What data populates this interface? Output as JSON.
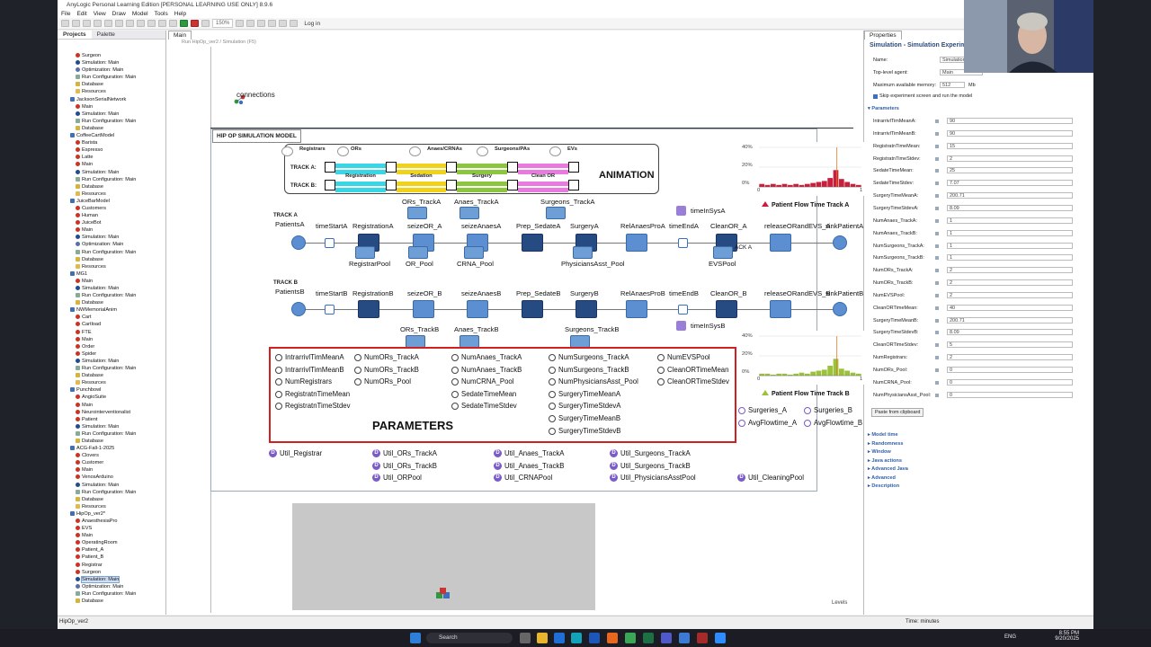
{
  "window": {
    "title": "AnyLogic Personal Learning Edition [PERSONAL LEARNING USE ONLY] 8.9.6",
    "menu": [
      "File",
      "Edit",
      "View",
      "Draw",
      "Model",
      "Tools",
      "Help"
    ],
    "zoom": "150%",
    "login": "Log in"
  },
  "left_panel": {
    "tabs": [
      "Projects",
      "Palette"
    ],
    "tree": [
      {
        "label": "Surgeon",
        "icon": "agent"
      },
      {
        "label": "Simulation: Main",
        "icon": "sim"
      },
      {
        "label": "Optimization: Main",
        "icon": "opt"
      },
      {
        "label": "Run Configuration: Main",
        "icon": "run"
      },
      {
        "label": "Database",
        "icon": "db"
      },
      {
        "label": "Resources",
        "icon": "folder"
      },
      {
        "label": "JacksonSerialNetwork",
        "icon": "model"
      },
      {
        "label": "Main",
        "icon": "agent"
      },
      {
        "label": "Simulation: Main",
        "icon": "sim"
      },
      {
        "label": "Run Configuration: Main",
        "icon": "run"
      },
      {
        "label": "Database",
        "icon": "db"
      },
      {
        "label": "CoffeeCartModel",
        "icon": "model"
      },
      {
        "label": "Barista",
        "icon": "agent"
      },
      {
        "label": "Espresso",
        "icon": "agent"
      },
      {
        "label": "Latte",
        "icon": "agent"
      },
      {
        "label": "Main",
        "icon": "agent"
      },
      {
        "label": "Simulation: Main",
        "icon": "sim"
      },
      {
        "label": "Run Configuration: Main",
        "icon": "run"
      },
      {
        "label": "Database",
        "icon": "db"
      },
      {
        "label": "Resources",
        "icon": "folder"
      },
      {
        "label": "JuiceBarModel",
        "icon": "model"
      },
      {
        "label": "Customers",
        "icon": "agent"
      },
      {
        "label": "Human",
        "icon": "agent"
      },
      {
        "label": "JuiceBot",
        "icon": "agent"
      },
      {
        "label": "Main",
        "icon": "agent"
      },
      {
        "label": "Simulation: Main",
        "icon": "sim"
      },
      {
        "label": "Optimization: Main",
        "icon": "opt"
      },
      {
        "label": "Run Configuration: Main",
        "icon": "run"
      },
      {
        "label": "Database",
        "icon": "db"
      },
      {
        "label": "Resources",
        "icon": "folder"
      },
      {
        "label": "MG1",
        "icon": "model"
      },
      {
        "label": "Main",
        "icon": "agent"
      },
      {
        "label": "Simulation: Main",
        "icon": "sim"
      },
      {
        "label": "Run Configuration: Main",
        "icon": "run"
      },
      {
        "label": "Database",
        "icon": "db"
      },
      {
        "label": "NWMemorialAnim",
        "icon": "model"
      },
      {
        "label": "Cart",
        "icon": "agent"
      },
      {
        "label": "Cartload",
        "icon": "agent"
      },
      {
        "label": "FTE",
        "icon": "agent"
      },
      {
        "label": "Main",
        "icon": "agent"
      },
      {
        "label": "Order",
        "icon": "agent"
      },
      {
        "label": "Spider",
        "icon": "agent"
      },
      {
        "label": "Simulation: Main",
        "icon": "sim"
      },
      {
        "label": "Run Configuration: Main",
        "icon": "run"
      },
      {
        "label": "Database",
        "icon": "db"
      },
      {
        "label": "Resources",
        "icon": "folder"
      },
      {
        "label": "Punchbowl",
        "icon": "model"
      },
      {
        "label": "AngioSuite",
        "icon": "agent"
      },
      {
        "label": "Main",
        "icon": "agent"
      },
      {
        "label": "Neurointerventionalist",
        "icon": "agent"
      },
      {
        "label": "Patient",
        "icon": "agent"
      },
      {
        "label": "Simulation: Main",
        "icon": "sim"
      },
      {
        "label": "Run Configuration: Main",
        "icon": "run"
      },
      {
        "label": "Database",
        "icon": "db"
      },
      {
        "label": "ACG-Fall-1-2025",
        "icon": "model"
      },
      {
        "label": "Clovers",
        "icon": "agent"
      },
      {
        "label": "Customer",
        "icon": "agent"
      },
      {
        "label": "Main",
        "icon": "agent"
      },
      {
        "label": "VenosArduino",
        "icon": "agent"
      },
      {
        "label": "Simulation: Main",
        "icon": "sim"
      },
      {
        "label": "Run Configuration: Main",
        "icon": "run"
      },
      {
        "label": "Database",
        "icon": "db"
      },
      {
        "label": "Resources",
        "icon": "folder"
      },
      {
        "label": "HipOp_ver2*",
        "icon": "model"
      },
      {
        "label": "AnaesthesiaPro",
        "icon": "agent"
      },
      {
        "label": "EVS",
        "icon": "agent"
      },
      {
        "label": "Main",
        "icon": "agent"
      },
      {
        "label": "OperatingRoom",
        "icon": "agent"
      },
      {
        "label": "Patient_A",
        "icon": "agent"
      },
      {
        "label": "Patient_B",
        "icon": "agent"
      },
      {
        "label": "Registrar",
        "icon": "agent"
      },
      {
        "label": "Surgeon",
        "icon": "agent"
      },
      {
        "label": "Simulation: Main",
        "icon": "sim",
        "selected": true
      },
      {
        "label": "Optimization: Main",
        "icon": "opt"
      },
      {
        "label": "Run Configuration: Main",
        "icon": "run"
      },
      {
        "label": "Database",
        "icon": "db"
      }
    ]
  },
  "editor": {
    "tab": "Main",
    "run_hint": "Run HipOp_ver2 / Simulation (F5)",
    "connections_label": "connections",
    "frame_title": "HIP OP SIMULATION MODEL",
    "animation": {
      "title": "ANIMATION",
      "resources": [
        "Registrars",
        "ORs",
        "Anaes/CRNAs",
        "Surgeons/PAs",
        "EVs"
      ],
      "track_a": "TRACK A:",
      "track_b": "TRACK B:",
      "stages": [
        "Registration",
        "Sedation",
        "Surgery",
        "Clean OR"
      ],
      "stage_colors": [
        "#39d6e6",
        "#f0d21a",
        "#8cc63f",
        "#e87ae0"
      ]
    },
    "track_a": {
      "label1": "TRACK A",
      "label2": "PatientsA",
      "blocks": [
        "timeStartA",
        "RegistrationA",
        "seizeOR_A",
        "seizeAnaesA",
        "Prep_SedateA",
        "SurgeryA",
        "RelAnaesProA",
        "timeEndA",
        "CleanOR_A",
        "releaseORandEVS_A",
        "sinkPatientA"
      ],
      "pools_top": [
        "ORs_TrackA",
        "Anaes_TrackA",
        "Surgeons_TrackA"
      ],
      "time_in_sys": "timeInSysA",
      "stray": "ACK A"
    },
    "pools_mid": [
      "RegistrarPool",
      "OR_Pool",
      "CRNA_Pool",
      "PhysiciansAsst_Pool",
      "EVSPool"
    ],
    "track_b": {
      "label1": "TRACK B",
      "label2": "PatientsB",
      "blocks": [
        "timeStartB",
        "RegistrationB",
        "seizeOR_B",
        "seizeAnaesB",
        "Prep_SedateB",
        "SurgeryB",
        "RelAnaesProB",
        "timeEndB",
        "CleanOR_B",
        "releaseORandEVS_B",
        "sinkPatientB"
      ],
      "pools_bottom": [
        "ORs_TrackB",
        "Anaes_TrackB",
        "Surgeons_TrackB"
      ],
      "time_in_sys": "timeInSysB"
    },
    "parameters": {
      "title": "PARAMETERS",
      "col1": [
        "IntrarrivlTimMeanA",
        "IntrarrivlTimMeanB",
        "NumRegistrars",
        "RegistratnTimeMean",
        "RegistratnTimeStdev"
      ],
      "col2": [
        "NumORs_TrackA",
        "NumORs_TrackB",
        "NumORs_Pool"
      ],
      "col3": [
        "NumAnaes_TrackA",
        "NumAnaes_TrackB",
        "NumCRNA_Pool",
        "SedateTimeMean",
        "SedateTimeStdev"
      ],
      "col4": [
        "NumSurgeons_TrackA",
        "NumSurgeons_TrackB",
        "NumPhysiciansAsst_Pool",
        "SurgeryTimeMeanA",
        "SurgeryTimeStdevA",
        "SurgeryTimeMeanB",
        "SurgeryTimeStdevB"
      ],
      "col5": [
        "NumEVSPool",
        "CleanORTimeMean",
        "CleanORTimeStdev"
      ]
    },
    "outputs": [
      "Surgeries_A",
      "Surgeries_B",
      "AvgFlowtime_A",
      "AvgFlowtime_B"
    ],
    "datasets": [
      "Util_Registrar",
      "Util_ORs_TrackA",
      "Util_ORs_TrackB",
      "Util_ORPool",
      "Util_Anaes_TrackA",
      "Util_Anaes_TrackB",
      "Util_CRNAPool",
      "Util_Surgeons_TrackA",
      "Util_Surgeons_TrackB",
      "Util_PhysiciansAsstPool",
      "Util_CleaningPool"
    ],
    "hist_a": {
      "title": "Patient Flow Time Track A",
      "color": "#c8203c",
      "yticks": [
        "40%",
        "20%",
        "0%"
      ],
      "xticks": [
        "0",
        "1"
      ],
      "bars": [
        0.03,
        0.02,
        0.03,
        0.02,
        0.03,
        0.02,
        0.03,
        0.02,
        0.03,
        0.04,
        0.05,
        0.06,
        0.09,
        0.17,
        0.08,
        0.05,
        0.03,
        0.02
      ]
    },
    "hist_b": {
      "title": "Patient Flow Time Track B",
      "color": "#9bc23a",
      "yticks": [
        "40%",
        "20%",
        "0%"
      ],
      "xticks": [
        "0",
        "1"
      ],
      "bars": [
        0.02,
        0.02,
        0.01,
        0.02,
        0.02,
        0.01,
        0.02,
        0.03,
        0.02,
        0.04,
        0.05,
        0.06,
        0.1,
        0.17,
        0.07,
        0.05,
        0.03,
        0.02
      ]
    },
    "levels": "Levels"
  },
  "right_panel": {
    "tab": "Properties",
    "title": "Simulation - Simulation Experiment",
    "name_label": "Name:",
    "name_value": "Simulation",
    "top_agent_label": "Top-level agent:",
    "top_agent_value": "Main",
    "memory_label": "Maximum available memory:",
    "memory_value": "512",
    "memory_unit": "Mb",
    "skip_label": "Skip experiment screen and run the model",
    "params_header": "Parameters",
    "params": [
      [
        "IntrarrivlTimMeanA:",
        "90"
      ],
      [
        "IntrarrivlTimMeanB:",
        "90"
      ],
      [
        "RegistratnTimeMean:",
        "15"
      ],
      [
        "RegistratnTimeStdev:",
        "2"
      ],
      [
        "SedateTimeMean:",
        "25"
      ],
      [
        "SedateTimeStdev:",
        "7.07"
      ],
      [
        "SurgeryTimeMeanA:",
        "200.71"
      ],
      [
        "SurgeryTimeStdevA:",
        "8.09"
      ],
      [
        "NumAnaes_TrackA:",
        "1"
      ],
      [
        "NumAnaes_TrackB:",
        "1"
      ],
      [
        "NumSurgeons_TrackA:",
        "1"
      ],
      [
        "NumSurgeons_TrackB:",
        "1"
      ],
      [
        "NumORs_TrackA:",
        "2"
      ],
      [
        "NumORs_TrackB:",
        "2"
      ],
      [
        "NumEVSPool:",
        "2"
      ],
      [
        "CleanORTimeMean:",
        "40"
      ],
      [
        "SurgeryTimeMeanB:",
        "200.71"
      ],
      [
        "SurgeryTimeStdevB:",
        "8.09"
      ],
      [
        "CleanORTimeStdev:",
        "5"
      ],
      [
        "NumRegistrars:",
        "2"
      ],
      [
        "NumORs_Pool:",
        "0"
      ],
      [
        "NumCRNA_Pool:",
        "0"
      ],
      [
        "NumPhysiciansAsst_Pool:",
        "0"
      ]
    ],
    "paste_button": "Paste from clipboard",
    "sections": [
      "Model time",
      "Randomness",
      "Window",
      "Java actions",
      "Advanced Java",
      "Advanced",
      "Description"
    ]
  },
  "status": {
    "left": "HipOp_ver2",
    "time_units": "Time: minutes"
  },
  "taskbar": {
    "search": "Search",
    "lang": "ENG",
    "time": "8:55 PM",
    "date": "9/20/2025"
  }
}
